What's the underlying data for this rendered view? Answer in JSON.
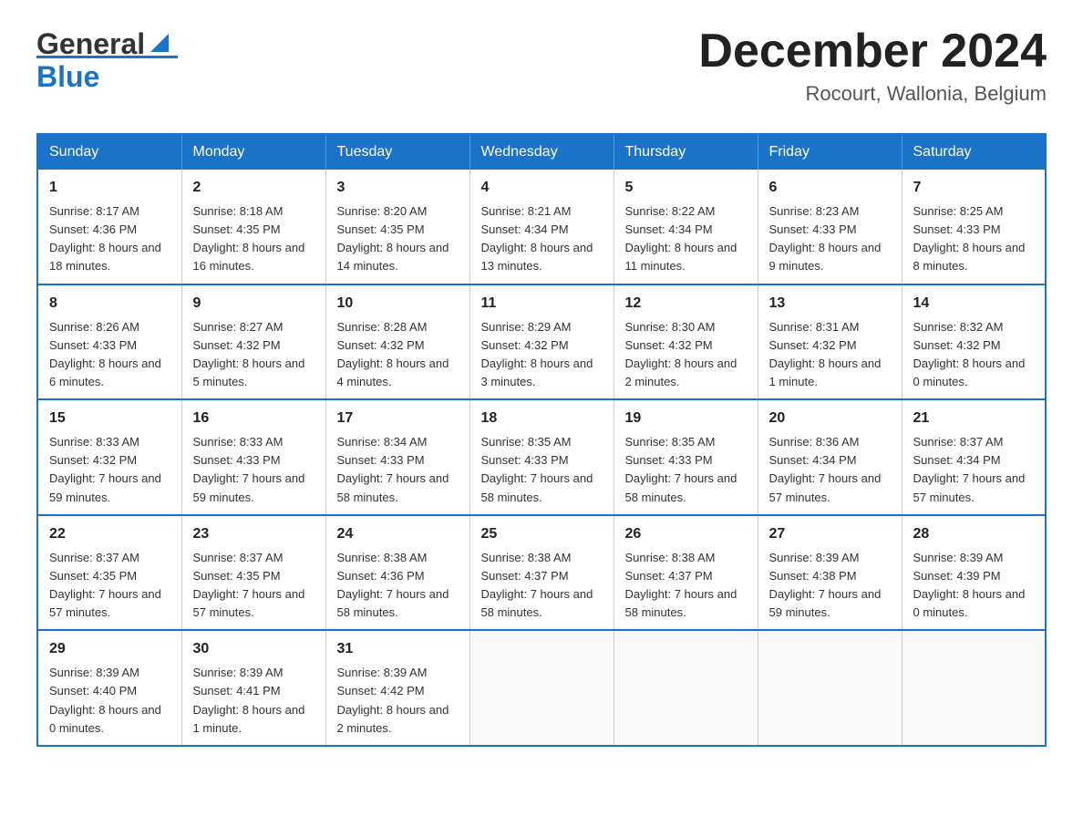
{
  "header": {
    "logo_text_general": "General",
    "logo_text_blue": "Blue",
    "month_title": "December 2024",
    "location": "Rocourt, Wallonia, Belgium"
  },
  "calendar": {
    "days_of_week": [
      "Sunday",
      "Monday",
      "Tuesday",
      "Wednesday",
      "Thursday",
      "Friday",
      "Saturday"
    ],
    "weeks": [
      [
        {
          "day": "1",
          "sunrise": "8:17 AM",
          "sunset": "4:36 PM",
          "daylight": "8 hours and 18 minutes."
        },
        {
          "day": "2",
          "sunrise": "8:18 AM",
          "sunset": "4:35 PM",
          "daylight": "8 hours and 16 minutes."
        },
        {
          "day": "3",
          "sunrise": "8:20 AM",
          "sunset": "4:35 PM",
          "daylight": "8 hours and 14 minutes."
        },
        {
          "day": "4",
          "sunrise": "8:21 AM",
          "sunset": "4:34 PM",
          "daylight": "8 hours and 13 minutes."
        },
        {
          "day": "5",
          "sunrise": "8:22 AM",
          "sunset": "4:34 PM",
          "daylight": "8 hours and 11 minutes."
        },
        {
          "day": "6",
          "sunrise": "8:23 AM",
          "sunset": "4:33 PM",
          "daylight": "8 hours and 9 minutes."
        },
        {
          "day": "7",
          "sunrise": "8:25 AM",
          "sunset": "4:33 PM",
          "daylight": "8 hours and 8 minutes."
        }
      ],
      [
        {
          "day": "8",
          "sunrise": "8:26 AM",
          "sunset": "4:33 PM",
          "daylight": "8 hours and 6 minutes."
        },
        {
          "day": "9",
          "sunrise": "8:27 AM",
          "sunset": "4:32 PM",
          "daylight": "8 hours and 5 minutes."
        },
        {
          "day": "10",
          "sunrise": "8:28 AM",
          "sunset": "4:32 PM",
          "daylight": "8 hours and 4 minutes."
        },
        {
          "day": "11",
          "sunrise": "8:29 AM",
          "sunset": "4:32 PM",
          "daylight": "8 hours and 3 minutes."
        },
        {
          "day": "12",
          "sunrise": "8:30 AM",
          "sunset": "4:32 PM",
          "daylight": "8 hours and 2 minutes."
        },
        {
          "day": "13",
          "sunrise": "8:31 AM",
          "sunset": "4:32 PM",
          "daylight": "8 hours and 1 minute."
        },
        {
          "day": "14",
          "sunrise": "8:32 AM",
          "sunset": "4:32 PM",
          "daylight": "8 hours and 0 minutes."
        }
      ],
      [
        {
          "day": "15",
          "sunrise": "8:33 AM",
          "sunset": "4:32 PM",
          "daylight": "7 hours and 59 minutes."
        },
        {
          "day": "16",
          "sunrise": "8:33 AM",
          "sunset": "4:33 PM",
          "daylight": "7 hours and 59 minutes."
        },
        {
          "day": "17",
          "sunrise": "8:34 AM",
          "sunset": "4:33 PM",
          "daylight": "7 hours and 58 minutes."
        },
        {
          "day": "18",
          "sunrise": "8:35 AM",
          "sunset": "4:33 PM",
          "daylight": "7 hours and 58 minutes."
        },
        {
          "day": "19",
          "sunrise": "8:35 AM",
          "sunset": "4:33 PM",
          "daylight": "7 hours and 58 minutes."
        },
        {
          "day": "20",
          "sunrise": "8:36 AM",
          "sunset": "4:34 PM",
          "daylight": "7 hours and 57 minutes."
        },
        {
          "day": "21",
          "sunrise": "8:37 AM",
          "sunset": "4:34 PM",
          "daylight": "7 hours and 57 minutes."
        }
      ],
      [
        {
          "day": "22",
          "sunrise": "8:37 AM",
          "sunset": "4:35 PM",
          "daylight": "7 hours and 57 minutes."
        },
        {
          "day": "23",
          "sunrise": "8:37 AM",
          "sunset": "4:35 PM",
          "daylight": "7 hours and 57 minutes."
        },
        {
          "day": "24",
          "sunrise": "8:38 AM",
          "sunset": "4:36 PM",
          "daylight": "7 hours and 58 minutes."
        },
        {
          "day": "25",
          "sunrise": "8:38 AM",
          "sunset": "4:37 PM",
          "daylight": "7 hours and 58 minutes."
        },
        {
          "day": "26",
          "sunrise": "8:38 AM",
          "sunset": "4:37 PM",
          "daylight": "7 hours and 58 minutes."
        },
        {
          "day": "27",
          "sunrise": "8:39 AM",
          "sunset": "4:38 PM",
          "daylight": "7 hours and 59 minutes."
        },
        {
          "day": "28",
          "sunrise": "8:39 AM",
          "sunset": "4:39 PM",
          "daylight": "8 hours and 0 minutes."
        }
      ],
      [
        {
          "day": "29",
          "sunrise": "8:39 AM",
          "sunset": "4:40 PM",
          "daylight": "8 hours and 0 minutes."
        },
        {
          "day": "30",
          "sunrise": "8:39 AM",
          "sunset": "4:41 PM",
          "daylight": "8 hours and 1 minute."
        },
        {
          "day": "31",
          "sunrise": "8:39 AM",
          "sunset": "4:42 PM",
          "daylight": "8 hours and 2 minutes."
        },
        null,
        null,
        null,
        null
      ]
    ]
  }
}
